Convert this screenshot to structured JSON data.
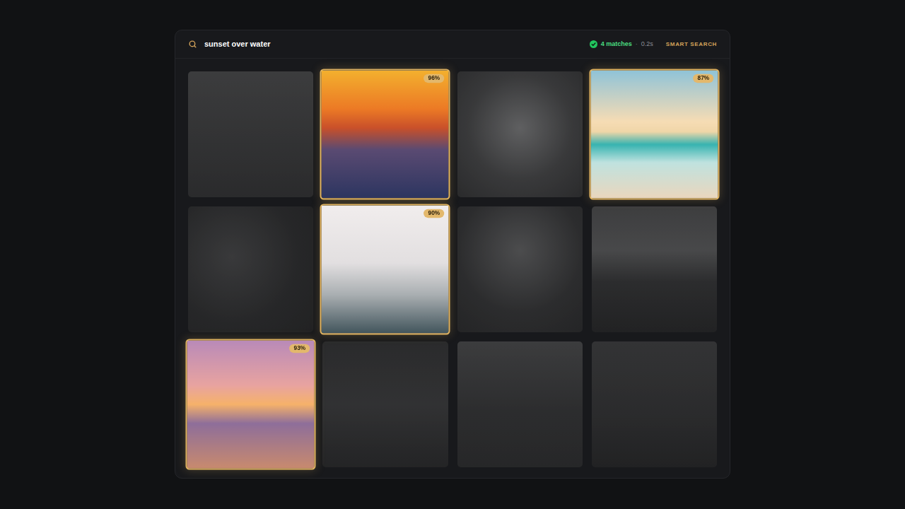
{
  "search": {
    "query": "sunset over water"
  },
  "status": {
    "matches": "4 matches",
    "separator": "·",
    "time": "0.2s"
  },
  "mode_button": "SMART SEARCH",
  "results": [
    {
      "matched": false
    },
    {
      "matched": true,
      "score": "96%"
    },
    {
      "matched": false
    },
    {
      "matched": true,
      "score": "87%"
    },
    {
      "matched": false
    },
    {
      "matched": true,
      "score": "90%"
    },
    {
      "matched": false
    },
    {
      "matched": false
    },
    {
      "matched": true,
      "score": "93%"
    },
    {
      "matched": false
    },
    {
      "matched": false
    },
    {
      "matched": false
    }
  ]
}
